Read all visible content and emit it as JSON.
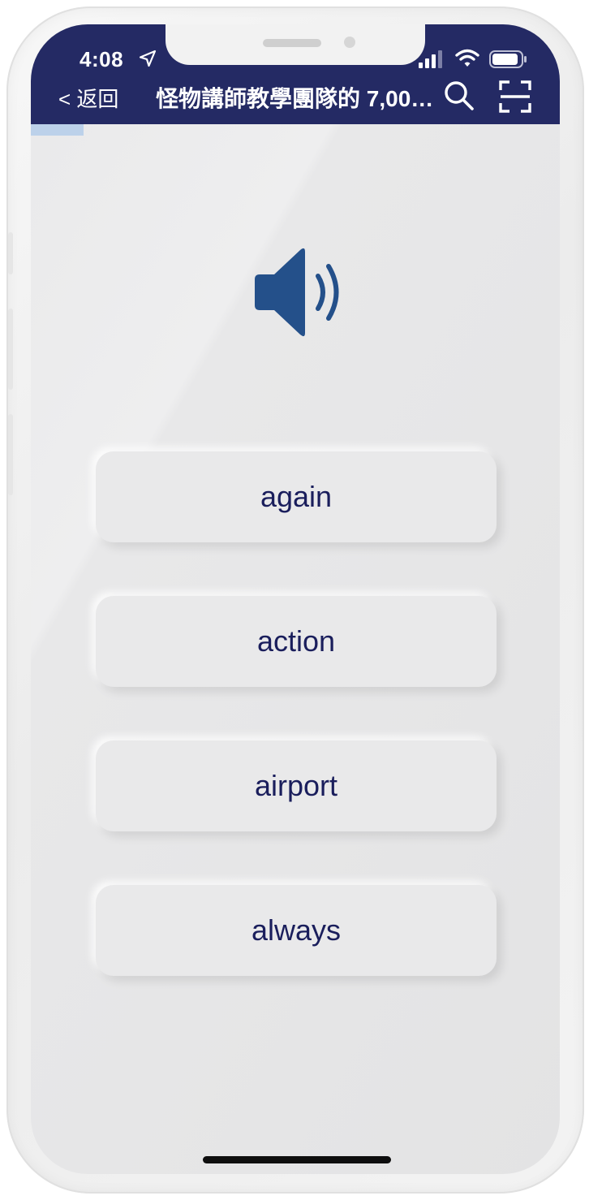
{
  "status_bar": {
    "time": "4:08"
  },
  "header": {
    "back_label": "< 返回",
    "title": "怪物講師教學團隊的 7,000…"
  },
  "progress": {
    "fraction": 0.1
  },
  "quiz": {
    "options": [
      "again",
      "action",
      "airport",
      "always"
    ]
  },
  "colors": {
    "header_bg": "#242a64",
    "accent": "#24508a",
    "option_text": "#1a1e5c",
    "progress_fill": "#bcd1ea"
  },
  "icons": {
    "location": "location-arrow-icon",
    "signal": "cellular-signal-icon",
    "wifi": "wifi-icon",
    "battery": "battery-icon",
    "search": "search-icon",
    "scan": "scan-icon",
    "audio": "speaker-volume-icon"
  }
}
